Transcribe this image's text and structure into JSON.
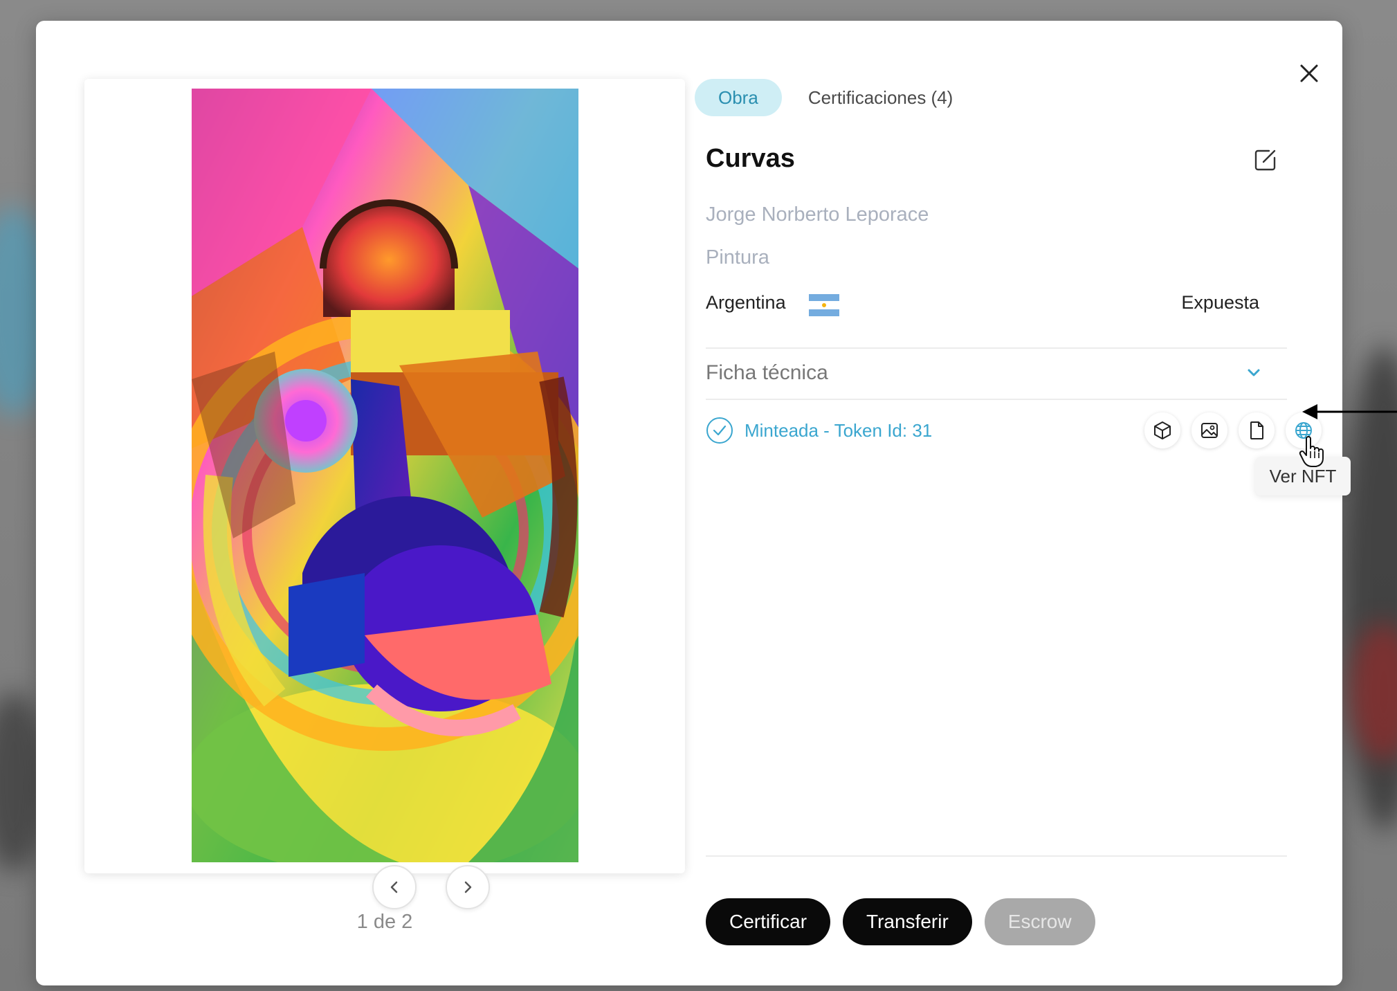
{
  "modal": {
    "tabs": [
      {
        "label": "Obra",
        "active": true
      },
      {
        "label": "Certificaciones (4)",
        "active": false
      }
    ],
    "title": "Curvas",
    "artist": "Jorge Norberto Leporace",
    "technique": "Pintura",
    "country": "Argentina",
    "status": "Expuesta",
    "ficha_label": "Ficha técnica",
    "minted_label": "Minteada - Token Id: 31",
    "tooltip": "Ver NFT",
    "pager": "1 de 2",
    "buttons": {
      "certify": "Certificar",
      "transfer": "Transferir",
      "escrow": "Escrow"
    }
  },
  "icons": {
    "close": "close-icon",
    "edit": "edit-icon",
    "flag": "argentina-flag-icon",
    "chevron": "chevron-down-icon",
    "check": "check-circle-icon",
    "actions": [
      "cube-icon",
      "image-icon",
      "document-icon",
      "globe-icon"
    ],
    "carousel": [
      "chevron-left-icon",
      "chevron-right-icon"
    ]
  },
  "colors": {
    "accent": "#3aa6cf",
    "tab_active_bg": "#cfeef5",
    "button_dark": "#0a0a0a",
    "button_disabled": "#a9a9a9"
  }
}
